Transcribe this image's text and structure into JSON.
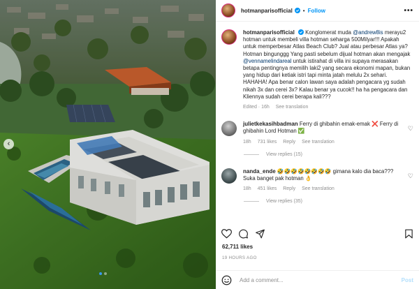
{
  "header": {
    "username": "hotmanparisofficial",
    "separator": "•",
    "follow_label": "Follow",
    "more_label": "•••"
  },
  "caption": {
    "username": "hotmanparisofficial",
    "text_before": " Konglomerat muda ",
    "mention1": "@andrew8is",
    "text_mid": " merayu2 hotman untuk membeli villa hotman seharga 500Milyar!!! Apakah untuk memperbesar Atlas Beach Club? Jual atau perbesar Atlas ya? Hotman bingunggg Yang pasti sebelum dijual hotman akan mengajak ",
    "mention2": "@vennamelindareal",
    "text_after": " untuk istirahat di villa ini supaya merasakan betapa pentingnya memilih laki2 yang secara ekonomi mapan, bukan yang hidup dari ketiak istri tapi minta jatah melulu 2x sehari. HAHAHA! Apa benar calon lawan saya adalah pengacara yg sudah nikah 3x dan cerei 3x? Kalau benar ya cucok!! ha ha pengacara dan Kliennya sudah cerei berapa kali???",
    "edited": "Edited · 16h",
    "see_translation": "See translation"
  },
  "comments": [
    {
      "username": "julietkekasihbadman",
      "text": " Ferry di ghibahin emak-emak ❌ Ferry di ghibahin Lord Hotman ✅",
      "time": "18h",
      "likes": "731 likes",
      "reply": "Reply",
      "see_translation": "See translation",
      "view_replies": "View replies (15)"
    },
    {
      "username": "nanda_ende",
      "text": " 🤣🤣🤣🤣🤣🤣🤣🤣 gimana kalo dia baca??? Suka banget pak hotman 👌",
      "time": "18h",
      "likes": "451 likes",
      "reply": "Reply",
      "see_translation": "See translation",
      "view_replies": "View replies (35)"
    }
  ],
  "likes_count": "62,711 likes",
  "time_ago": "19 HOURS AGO",
  "add_comment": {
    "placeholder": "Add a comment...",
    "post_label": "Post"
  },
  "carousel": {
    "prev_icon": "chevron-left-icon",
    "slides": 2,
    "active_slide": 1
  },
  "colors": {
    "accent": "#0095f6",
    "link": "#00376b",
    "muted": "#8e8e8e",
    "verified": "#0095f6"
  }
}
